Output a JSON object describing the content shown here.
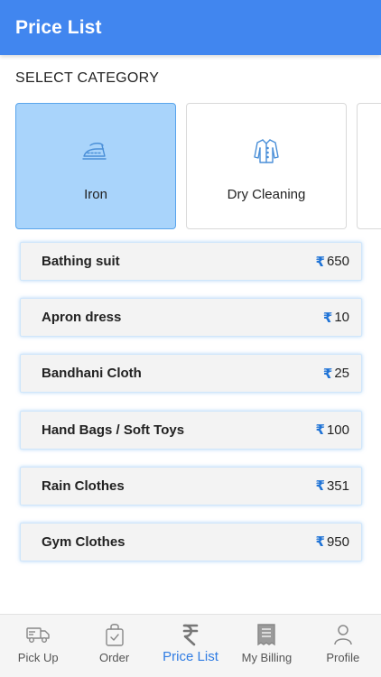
{
  "header": {
    "title": "Price List",
    "color": "#4186ef"
  },
  "section": {
    "label": "SELECT CATEGORY"
  },
  "categories": [
    {
      "label": "Iron",
      "icon": "iron-icon",
      "selected": true
    },
    {
      "label": "Dry Cleaning",
      "icon": "shirt-icon",
      "selected": false
    },
    {
      "label": "",
      "icon": "",
      "selected": false
    }
  ],
  "currency_symbol": "₹",
  "items": [
    {
      "name": "Bathing suit",
      "price": "650"
    },
    {
      "name": "Apron dress",
      "price": "10"
    },
    {
      "name": "Bandhani Cloth",
      "price": "25"
    },
    {
      "name": "Hand Bags / Soft Toys",
      "price": "100"
    },
    {
      "name": "Rain Clothes",
      "price": "351"
    },
    {
      "name": "Gym Clothes",
      "price": "950"
    }
  ],
  "nav": [
    {
      "label": "Pick Up",
      "icon": "truck-icon",
      "active": false
    },
    {
      "label": "Order",
      "icon": "shopping-bag-icon",
      "active": false
    },
    {
      "label": "Price List",
      "icon": "rupee-icon",
      "active": true
    },
    {
      "label": "My Billing",
      "icon": "receipt-icon",
      "active": false
    },
    {
      "label": "Profile",
      "icon": "user-icon",
      "active": false
    }
  ],
  "colors": {
    "accent": "#2f7ce3",
    "selected_card": "#a9d4fb",
    "rupee": "#1f73d6"
  }
}
